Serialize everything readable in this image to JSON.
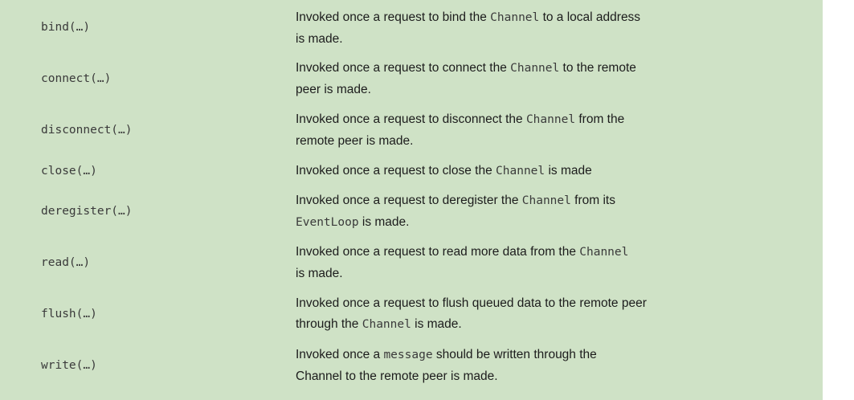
{
  "rows": [
    {
      "method": "bind(…)",
      "desc": [
        {
          "t": "Invoked once a request to bind the "
        },
        {
          "t": "Channel",
          "code": true
        },
        {
          "t": " to a local address"
        },
        {
          "br": true
        },
        {
          "t": "is made."
        }
      ]
    },
    {
      "method": "connect(…)",
      "desc": [
        {
          "t": "Invoked once a request to connect the "
        },
        {
          "t": "Channel",
          "code": true
        },
        {
          "t": " to the remote"
        },
        {
          "br": true
        },
        {
          "t": "peer is made."
        }
      ]
    },
    {
      "method": "disconnect(…)",
      "desc": [
        {
          "t": "Invoked once a request to disconnect the "
        },
        {
          "t": "Channel",
          "code": true
        },
        {
          "t": " from the"
        },
        {
          "br": true
        },
        {
          "t": "remote peer is made."
        }
      ]
    },
    {
      "method": "close(…)",
      "desc": [
        {
          "t": "Invoked once a request to close the "
        },
        {
          "t": "Channel",
          "code": true
        },
        {
          "t": " is made"
        }
      ]
    },
    {
      "method": "deregister(…)",
      "desc": [
        {
          "t": "Invoked once a request to deregister the "
        },
        {
          "t": "Channel",
          "code": true
        },
        {
          "t": " from its"
        },
        {
          "br": true
        },
        {
          "t": "EventLoop",
          "code": true
        },
        {
          "t": " is made."
        }
      ]
    },
    {
      "method": "read(…)",
      "desc": [
        {
          "t": "Invoked once a request to read more data from the "
        },
        {
          "t": "Channel",
          "code": true
        },
        {
          "br": true
        },
        {
          "t": "is made."
        }
      ]
    },
    {
      "method": "flush(…)",
      "desc": [
        {
          "t": "Invoked once a request to flush queued data to the remote peer"
        },
        {
          "br": true
        },
        {
          "t": "through the "
        },
        {
          "t": "Channel",
          "code": true
        },
        {
          "t": " is made."
        }
      ]
    },
    {
      "method": "write(…)",
      "desc": [
        {
          "t": "Invoked once a "
        },
        {
          "t": "message",
          "code": true
        },
        {
          "t": " should be written through the"
        },
        {
          "br": true
        },
        {
          "t": "Channel to the remote peer is made."
        }
      ]
    }
  ]
}
